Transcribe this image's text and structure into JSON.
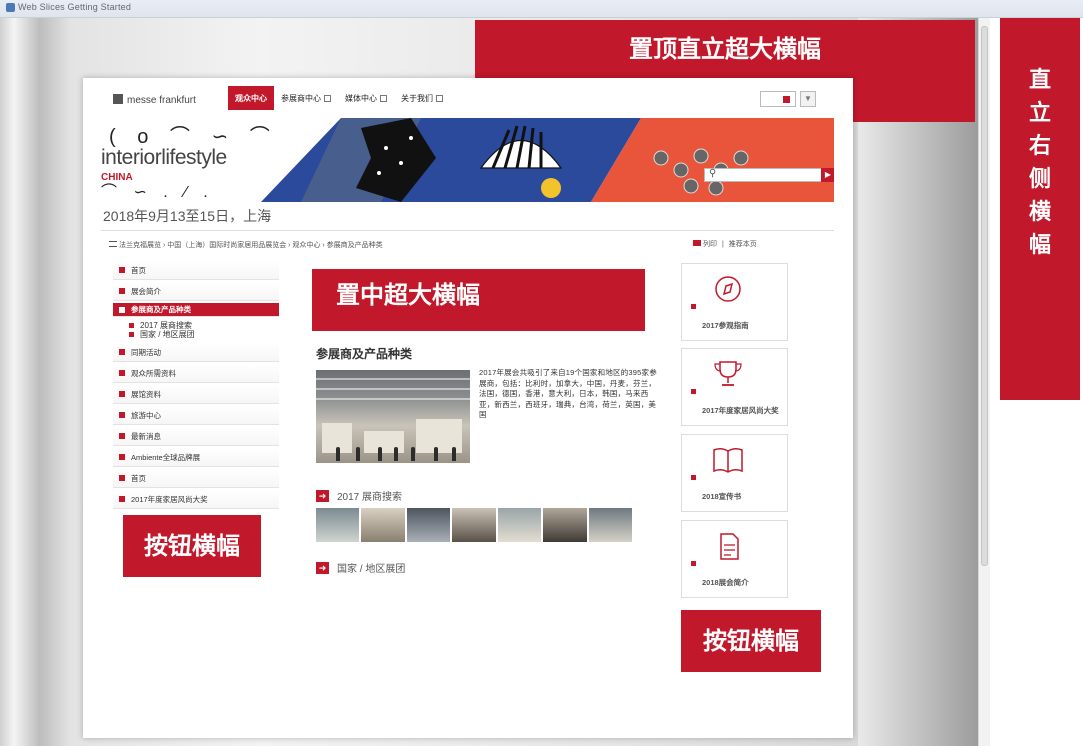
{
  "browser": {
    "tab_text": "Web Slices  Getting Started"
  },
  "ads": {
    "top_banner": "置顶直立超大横幅",
    "right_vertical": [
      "直",
      "立",
      "右",
      "侧",
      "横",
      "幅"
    ],
    "center_banner": "置中超大横幅",
    "left_button_banner": "按钮横幅",
    "right_button_banner": "按钮横幅"
  },
  "header": {
    "logo": "messe frankfurt",
    "nav": [
      {
        "label": "观众中心",
        "active": true
      },
      {
        "label": "参展商中心",
        "active": false
      },
      {
        "label": "媒体中心",
        "active": false
      },
      {
        "label": "关于我们",
        "active": false
      }
    ],
    "lang_arrow": "▼"
  },
  "hero": {
    "brand": "interiorlifestyle",
    "brand_sub": "CHINA",
    "search_placeholder": "",
    "search_button": "▶"
  },
  "event": {
    "date": "2018年9月13至15日，上海"
  },
  "breadcrumb": "法兰克福展览 › 中国（上海）国际时尚家居用品展览会 › 观众中心 › 参展商及产品种类",
  "tools": {
    "print": "列印",
    "recommend": "推荐本页"
  },
  "sidebar": {
    "items": [
      {
        "label": "首页",
        "active": false
      },
      {
        "label": "展会简介",
        "active": false
      },
      {
        "label": "参展商及产品种类",
        "active": true
      }
    ],
    "sub": [
      "2017 展商搜索",
      "国家 / 地区展团"
    ],
    "items2": [
      {
        "label": "同期活动"
      },
      {
        "label": "观众所需资料"
      },
      {
        "label": "展馆资料"
      },
      {
        "label": "旅游中心"
      },
      {
        "label": "最新消息"
      },
      {
        "label": "Ambiente全球品牌展"
      },
      {
        "label": "首页"
      },
      {
        "label": "2017年度家居风尚大奖"
      }
    ]
  },
  "main": {
    "title": "参展商及产品种类",
    "description": "2017年展会共吸引了来自19个国家和地区的395家参展商，包括：比利时，加拿大，中国，丹麦，芬兰，法国，德国，香港，意大利，日本，韩国，马来西亚，新西兰，西班牙，瑞典，台湾，荷兰，英国，美国",
    "link1": "2017 展商搜索",
    "link2": "国家 / 地区展团",
    "arrow": "➜"
  },
  "cards": [
    {
      "label": "2017参观指南",
      "icon": "compass-icon"
    },
    {
      "label": "2017年度家居风尚大奖",
      "icon": "trophy-icon"
    },
    {
      "label": "2018宣传书",
      "icon": "book-icon"
    },
    {
      "label": "2018展会简介",
      "icon": "document-icon"
    }
  ],
  "colors": {
    "brand_red": "#c1192b"
  }
}
